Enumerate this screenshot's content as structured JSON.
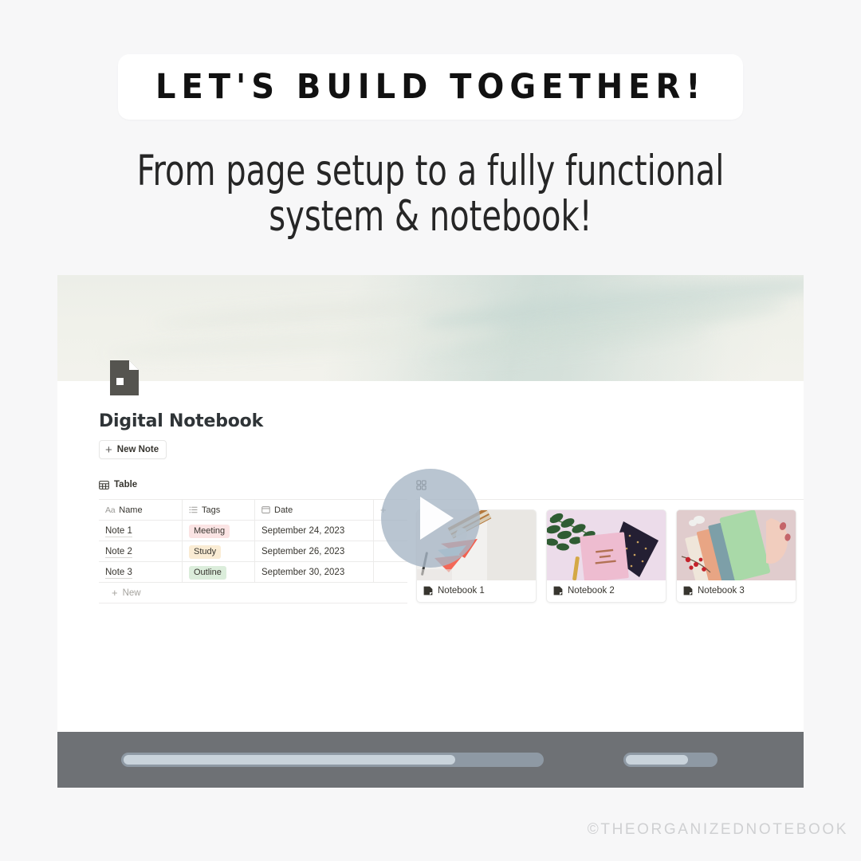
{
  "promo": {
    "headline": "LET'S BUILD TOGETHER!",
    "subtitle": "From page setup to a fully functional system & notebook!",
    "watermark": "©THEORGANIZEDNOTEBOOK"
  },
  "colors": {
    "page_background": "#f7f7f8",
    "headline_pill": "#ffffff",
    "headline_text": "#111111",
    "subtitle_text": "#262626",
    "cover_cream": "#f0f1ea",
    "cover_sage": "#c5d7d1",
    "player_bar": "#6e7175",
    "player_track": "#8e99a4",
    "player_fill": "#c9d3db",
    "play_overlay": "#a8b7c6",
    "watermark": "#cfd0d2",
    "tag_meeting": "#fbe4e4",
    "tag_study": "#faecd4",
    "tag_outline": "#dbeddb"
  },
  "notebook_page": {
    "icon": "page-icon",
    "title": "Digital Notebook",
    "new_note_button": {
      "icon": "plus-icon",
      "label": "New Note"
    },
    "table_view": {
      "tab_icon": "table-icon",
      "tab_label": "Table",
      "columns": [
        {
          "label": "Name",
          "icon": "text-property-icon",
          "prefix": "Aa"
        },
        {
          "label": "Tags",
          "icon": "multiselect-icon",
          "prefix": ""
        },
        {
          "label": "Date",
          "icon": "calendar-icon",
          "prefix": ""
        },
        {
          "label": "",
          "icon": "add-column-icon",
          "prefix": ""
        }
      ],
      "rows": [
        {
          "name": "Note 1",
          "tag": "Meeting",
          "tag_color": "#fbe4e4",
          "date": "September 24, 2023"
        },
        {
          "name": "Note 2",
          "tag": "Study",
          "tag_color": "#faecd4",
          "date": "September 26, 2023"
        },
        {
          "name": "Note 3",
          "tag": "Outline",
          "tag_color": "#dbeddb",
          "date": "September 30, 2023"
        }
      ],
      "new_row_label": "New",
      "new_row_icon": "plus-icon"
    },
    "gallery_view": {
      "tab_icon": "gallery-grid-icon",
      "cards": [
        {
          "title": "Notebook 1",
          "icon": "note-page-icon"
        },
        {
          "title": "Notebook 2",
          "icon": "note-page-icon"
        },
        {
          "title": "Notebook 3",
          "icon": "note-page-icon"
        },
        {
          "title": "",
          "icon": ""
        }
      ]
    }
  },
  "player": {
    "progress_label": "80",
    "volume_label": "70"
  }
}
